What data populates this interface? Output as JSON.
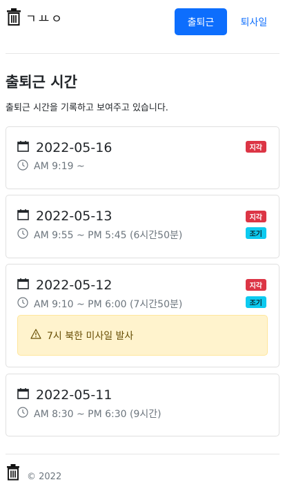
{
  "header": {
    "logo_icon": "trash-icon",
    "logo_text": "ㄱㅛㅇ",
    "clock_in_label": "출퇴근",
    "clock_out_label": "퇴사일"
  },
  "page": {
    "title": "출퇴근 시간",
    "subtitle": "출퇴근 시간을 기록하고 보여주고 있습니다."
  },
  "records": [
    {
      "date": "2022-05-16",
      "time": "AM 9:19 ~",
      "badges": [
        "지각"
      ]
    },
    {
      "date": "2022-05-13",
      "time": "AM 9:55 ~ PM 5:45 (6시간50분)",
      "badges": [
        "지각",
        "조기"
      ]
    },
    {
      "date": "2022-05-12",
      "time": "AM 9:10 ~ PM 6:00 (7시간50분)",
      "badges": [
        "지각",
        "조기"
      ],
      "alert": "7시 북한 미사일 발사"
    },
    {
      "date": "2022-05-11",
      "time": "AM 8:30 ~ PM 6:30 (9시간)",
      "badges": []
    }
  ],
  "footer": {
    "icon": "trash-icon",
    "copyright": "© 2022"
  },
  "colors": {
    "primary": "#0d6efd",
    "late_badge": "#dc3545",
    "early_badge": "#0dcaf0",
    "alert_bg": "#fff3cd"
  }
}
